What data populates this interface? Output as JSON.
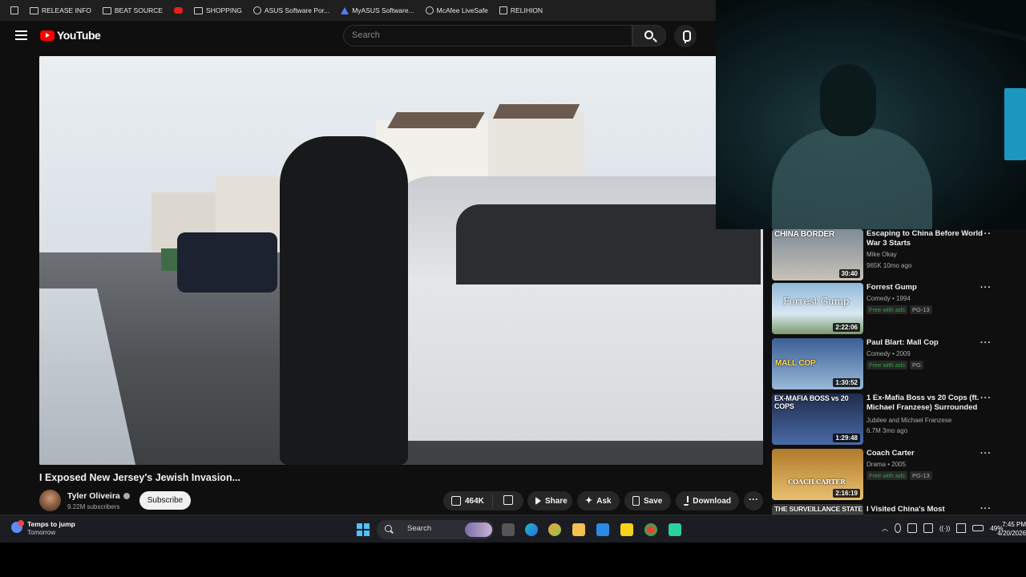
{
  "bookmarks": [
    {
      "label": "",
      "icon": "apps-icon"
    },
    {
      "label": "RELEASE INFO",
      "icon": "folder-icon"
    },
    {
      "label": "BEAT SOURCE",
      "icon": "folder-icon"
    },
    {
      "label": "",
      "icon": "youtube-icon"
    },
    {
      "label": "SHOPPING",
      "icon": "folder-icon"
    },
    {
      "label": "ASUS Software Por...",
      "icon": "globe-icon"
    },
    {
      "label": "MyASUS Software...",
      "icon": "asus-icon"
    },
    {
      "label": "McAfee LiveSafe",
      "icon": "globe-icon"
    },
    {
      "label": "RELIHION",
      "icon": "grid-icon"
    }
  ],
  "masthead": {
    "logo": "YouTube",
    "search_placeholder": "Search"
  },
  "video": {
    "title": "I Exposed New Jersey's Jewish Invasion...",
    "channel": "Tyler Oliveira",
    "subscribers": "9.22M subscribers",
    "subscribe_label": "Subscribe",
    "likes": "464K",
    "share_label": "Share",
    "ask_label": "Ask",
    "save_label": "Save",
    "download_label": "Download"
  },
  "recommendations": [
    {
      "thumb_text": "CHINA BORDER",
      "duration": "30:40",
      "title": "Escaping to China Before World War 3 Starts",
      "meta1": "Mike Okay",
      "meta2": "965K  10mo ago",
      "thumb_colors": [
        "#6b7a88",
        "#c9c2b8"
      ]
    },
    {
      "thumb_text": "Forrest Gump",
      "duration": "2:22:06",
      "title": "Forrest Gump",
      "meta1": "Comedy • 1994",
      "free": "Free with ads",
      "rating": "PG-13",
      "thumb_colors": [
        "#8fb7d8",
        "#d9e8f2"
      ]
    },
    {
      "thumb_text": "MALL COP",
      "duration": "1:30:52",
      "title": "Paul Blart: Mall Cop",
      "meta1": "Comedy • 2009",
      "free": "Free with ads",
      "rating": "PG",
      "thumb_colors": [
        "#2b4c7e",
        "#9ab8d8"
      ]
    },
    {
      "thumb_text": "EX-MAFIA BOSS vs 20 COPS",
      "duration": "1:29:48",
      "title": "1 Ex-Mafia Boss vs 20 Cops (ft. Michael Franzese) Surrounded",
      "meta1": "Jubilee  and Michael Franzese",
      "meta2": "6.7M  3mo ago",
      "thumb_colors": [
        "#1f2c4a",
        "#4a6aa8"
      ]
    },
    {
      "thumb_text": "COACH CARTER",
      "duration": "2:16:19",
      "title": "Coach Carter",
      "meta1": "Drama • 2005",
      "free": "Free with ads",
      "rating": "PG-13",
      "thumb_colors": [
        "#b07a2a",
        "#e8c070"
      ]
    },
    {
      "thumb_text": "THE SURVEILLANCE STATE",
      "duration": "",
      "title": "I Visited China's Most",
      "meta1": "",
      "thumb_colors": [
        "#3a3a3a",
        "#777"
      ]
    }
  ],
  "taskbar": {
    "weather_title": "Temps to jump",
    "weather_sub": "Tomorrow",
    "search_label": "Search",
    "battery": "49%",
    "time": "7:45 PM",
    "date": "4/20/2026"
  },
  "colors": {
    "youtube_red": "#ff0000",
    "background": "#0f0f0f",
    "free_green": "#2ba640"
  }
}
